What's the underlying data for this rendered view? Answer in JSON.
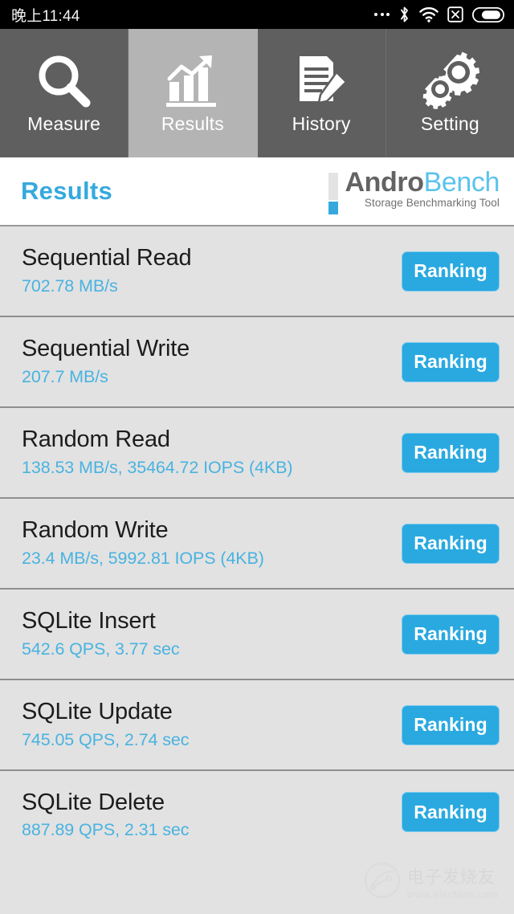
{
  "statusbar": {
    "clock": "晚上11:44",
    "icons": [
      {
        "name": "more-dots-icon",
        "label": "..."
      },
      {
        "name": "bluetooth-icon",
        "label": "Bluetooth"
      },
      {
        "name": "wifi-icon",
        "label": "Wi-Fi"
      },
      {
        "name": "no-sim-icon",
        "label": "No SIM"
      },
      {
        "name": "battery-icon",
        "label": "Battery"
      }
    ]
  },
  "tabs": [
    {
      "label": "Measure",
      "icon": "magnifier-icon",
      "active": false
    },
    {
      "label": "Results",
      "icon": "bar-chart-arrow-icon",
      "active": true
    },
    {
      "label": "History",
      "icon": "document-pencil-icon",
      "active": false
    },
    {
      "label": "Setting",
      "icon": "gears-icon",
      "active": false
    }
  ],
  "header": {
    "page_title": "Results",
    "logo": {
      "name_first": "Andro",
      "name_second": "Bench",
      "tagline": "Storage Benchmarking Tool"
    }
  },
  "results": [
    {
      "title": "Sequential Read",
      "value": "702.78 MB/s",
      "button": "Ranking"
    },
    {
      "title": "Sequential Write",
      "value": "207.7 MB/s",
      "button": "Ranking"
    },
    {
      "title": "Random Read",
      "value": "138.53 MB/s, 35464.72 IOPS (4KB)",
      "button": "Ranking"
    },
    {
      "title": "Random Write",
      "value": "23.4 MB/s, 5992.81 IOPS (4KB)",
      "button": "Ranking"
    },
    {
      "title": "SQLite Insert",
      "value": "542.6 QPS, 3.77 sec",
      "button": "Ranking"
    },
    {
      "title": "SQLite Update",
      "value": "745.05 QPS, 2.74 sec",
      "button": "Ranking"
    },
    {
      "title": "SQLite Delete",
      "value": "887.89 QPS, 2.31 sec",
      "button": "Ranking"
    }
  ],
  "watermark": {
    "cn": "电子发烧友",
    "url": "www.elecfans.com"
  },
  "colors": {
    "accent_blue": "#29a9e0",
    "value_blue": "#49b3e0",
    "logo_bench_blue": "#5bc3ec",
    "tab_inactive": "#5f5f5f",
    "tab_active": "#b4b4b4",
    "row_bg": "#e2e2e2",
    "divider": "#8e8e8e"
  }
}
